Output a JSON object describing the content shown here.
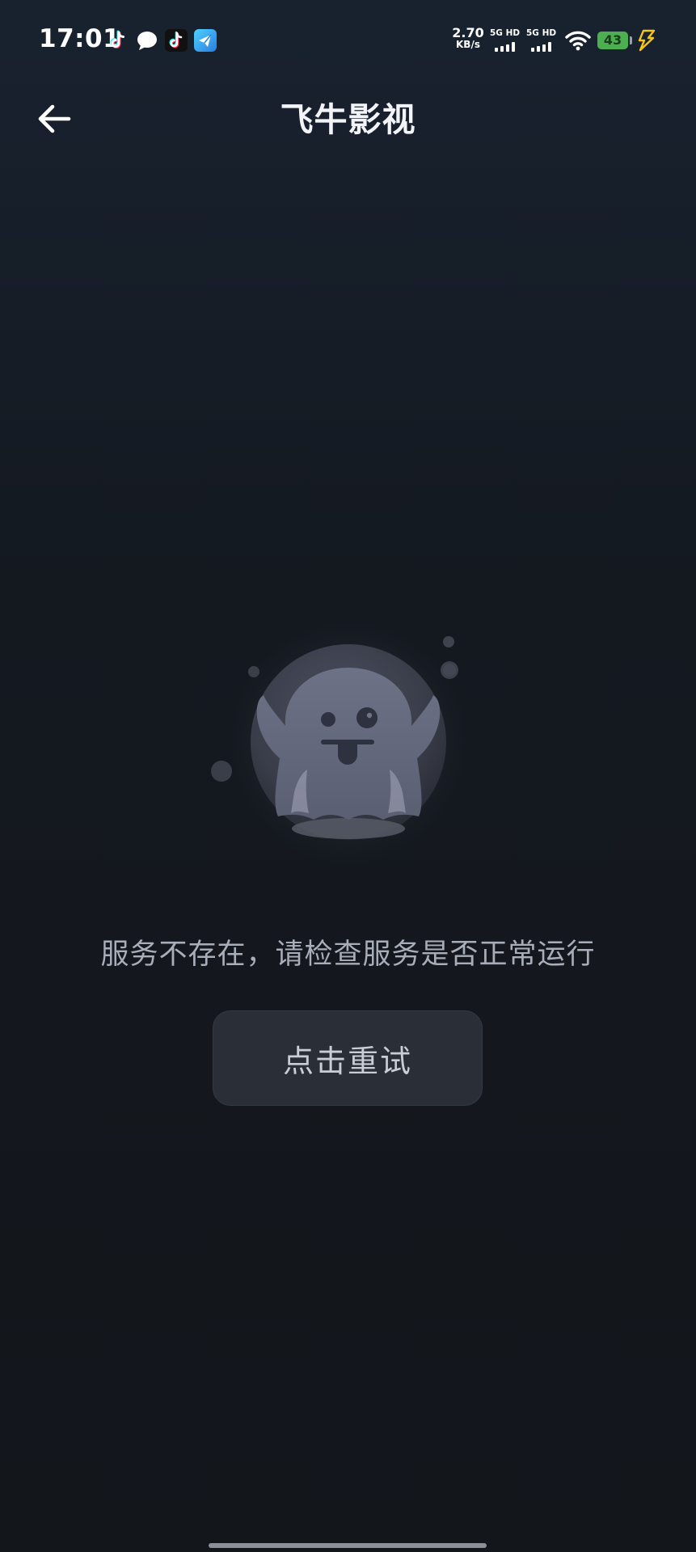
{
  "status_bar": {
    "time": "17:01",
    "net_speed_value": "2.70",
    "net_speed_unit": "KB/s",
    "sim1_label": "5G HD",
    "sim2_label": "5G HD",
    "battery_level": "43",
    "icons": [
      "tiktok-icon",
      "message-icon",
      "tiktok-icon",
      "messenger-app-icon",
      "wifi-icon",
      "battery-icon",
      "charging-icon"
    ],
    "battery_color": "#4caf50",
    "charging_color": "#f5c518"
  },
  "app_bar": {
    "title": "飞牛影视",
    "back_icon": "arrow-left-icon"
  },
  "empty_state": {
    "illustration": "ghost-illustration",
    "message": "服务不存在，请检查服务是否正常运行",
    "retry_label": "点击重试"
  },
  "colors": {
    "background_top": "#18222f",
    "background_bottom": "#13161b",
    "button_bg": "#2a2e37",
    "text_secondary": "#a8aeb9"
  }
}
